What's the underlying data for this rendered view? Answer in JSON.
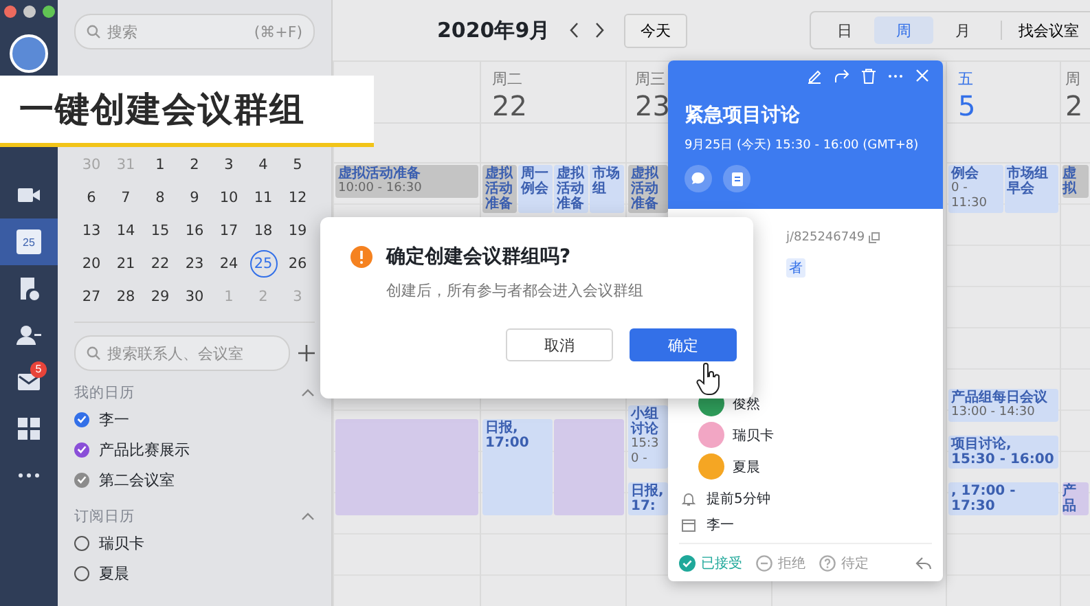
{
  "rail": {
    "items": [
      {
        "kind": "video",
        "selected": false
      },
      {
        "kind": "calendar",
        "label": "25",
        "selected": true
      },
      {
        "kind": "docs",
        "selected": false
      },
      {
        "kind": "contacts",
        "selected": false
      },
      {
        "kind": "mail",
        "badge": "5",
        "selected": false
      },
      {
        "kind": "apps",
        "selected": false
      },
      {
        "kind": "more",
        "selected": false
      }
    ]
  },
  "caption": "一键创建会议群组",
  "sidebar": {
    "search": {
      "placeholder": "搜索",
      "shortcut": "(⌘+F)"
    },
    "mini_calendar": {
      "weeks": [
        [
          {
            "label": "30",
            "muted": true,
            "selected": false
          },
          {
            "label": "31",
            "muted": true,
            "selected": false
          },
          {
            "label": "1",
            "muted": false,
            "selected": false
          },
          {
            "label": "2",
            "muted": false,
            "selected": false
          },
          {
            "label": "3",
            "muted": false,
            "selected": false
          },
          {
            "label": "4",
            "muted": false,
            "selected": false
          },
          {
            "label": "5",
            "muted": false,
            "selected": false
          }
        ],
        [
          {
            "label": "6",
            "muted": false,
            "selected": false
          },
          {
            "label": "7",
            "muted": false,
            "selected": false
          },
          {
            "label": "8",
            "muted": false,
            "selected": false
          },
          {
            "label": "9",
            "muted": false,
            "selected": false
          },
          {
            "label": "10",
            "muted": false,
            "selected": false
          },
          {
            "label": "11",
            "muted": false,
            "selected": false
          },
          {
            "label": "12",
            "muted": false,
            "selected": false
          }
        ],
        [
          {
            "label": "13",
            "muted": false,
            "selected": false
          },
          {
            "label": "14",
            "muted": false,
            "selected": false
          },
          {
            "label": "15",
            "muted": false,
            "selected": false
          },
          {
            "label": "16",
            "muted": false,
            "selected": false
          },
          {
            "label": "17",
            "muted": false,
            "selected": false
          },
          {
            "label": "18",
            "muted": false,
            "selected": false
          },
          {
            "label": "19",
            "muted": false,
            "selected": false
          }
        ],
        [
          {
            "label": "20",
            "muted": false,
            "selected": false
          },
          {
            "label": "21",
            "muted": false,
            "selected": false
          },
          {
            "label": "22",
            "muted": false,
            "selected": false
          },
          {
            "label": "23",
            "muted": false,
            "selected": false
          },
          {
            "label": "24",
            "muted": false,
            "selected": false
          },
          {
            "label": "25",
            "muted": false,
            "selected": true
          },
          {
            "label": "26",
            "muted": false,
            "selected": false
          }
        ],
        [
          {
            "label": "27",
            "muted": false,
            "selected": false
          },
          {
            "label": "28",
            "muted": false,
            "selected": false
          },
          {
            "label": "29",
            "muted": false,
            "selected": false
          },
          {
            "label": "30",
            "muted": false,
            "selected": false
          },
          {
            "label": "1",
            "muted": true,
            "selected": false
          },
          {
            "label": "2",
            "muted": true,
            "selected": false
          },
          {
            "label": "3",
            "muted": true,
            "selected": false
          }
        ]
      ]
    },
    "contact_search": {
      "placeholder": "搜索联系人、会议室"
    },
    "sections": [
      {
        "title": "我的日历",
        "expanded": true,
        "items": [
          {
            "label": "李一",
            "checked": true,
            "color": "#3370e8"
          },
          {
            "label": "产品比赛展示",
            "checked": true,
            "color": "#8a4fd8"
          },
          {
            "label": "第二会议室",
            "checked": true,
            "color": "#8c8c8c"
          }
        ]
      },
      {
        "title": "订阅日历",
        "expanded": true,
        "items": [
          {
            "label": "瑞贝卡",
            "checked": false,
            "color": "#555555"
          },
          {
            "label": "夏晨",
            "checked": false,
            "color": "#555555"
          }
        ]
      }
    ]
  },
  "header": {
    "title": "2020年9月",
    "today_button": "今天",
    "views": [
      {
        "label": "日",
        "selected": false
      },
      {
        "label": "周",
        "selected": true
      },
      {
        "label": "月",
        "selected": false
      }
    ],
    "room_button": "找会议室"
  },
  "columns": [
    {
      "rows": [
        [
          {
            "title": "虚拟活动准备",
            "time": "10:00 - 16:30",
            "color": "#c4c4c4"
          }
        ],
        [
          {
            "color": "#d3c9ea"
          }
        ]
      ]
    },
    {
      "weekday": "周二",
      "date": "22",
      "today": false,
      "rows": [
        [
          {
            "title": "虚拟活动准备",
            "color": "#c4c4c4"
          },
          {
            "title": "周一例会",
            "color": "#cfdcf5"
          },
          {
            "title": "虚拟活动准备",
            "color": "#cfdcf5"
          },
          {
            "title": "市场组",
            "color": "#cfdcf5"
          }
        ],
        [
          {
            "title": "日报, 17:00",
            "color": "#cfdcf5"
          },
          {
            "color": "#d3c9ea"
          }
        ]
      ]
    },
    {
      "weekday": "周三",
      "date": "23",
      "today": false,
      "rows": [
        [
          {
            "title": "虚拟活动准备",
            "color": "#c4c4c4"
          }
        ],
        [
          {
            "title": "小组讨论",
            "time": "15:30 -",
            "color": "#cfdcf5"
          }
        ],
        [
          {
            "title": "日报, 17:",
            "color": "#cfdcf5"
          }
        ]
      ]
    },
    {
      "weekday": "五",
      "date": "5",
      "today": true,
      "rows": [
        [
          {
            "title": "例会",
            "time": "0 - 11:30",
            "color": "#cfdcf5"
          },
          {
            "title": "市场组早会",
            "color": "#cfdcf5"
          }
        ],
        [
          {
            "title": "产品组每日会议",
            "time": "13:00 - 14:30",
            "color": "#cfdcf5"
          }
        ],
        [
          {
            "title": "项目讨论, 15:30 - 16:00",
            "color": "#cfdcf5"
          }
        ],
        [
          {
            "title": ", 17:00 - 17:30",
            "color": "#cfdcf5"
          }
        ]
      ]
    },
    {
      "weekday": "周",
      "date": "2",
      "today": false,
      "rows": [
        [
          {
            "title": "虚拟",
            "color": "#c4c4c4"
          }
        ],
        [
          {
            "title": "产品",
            "color": "#d3c9ea"
          }
        ]
      ]
    }
  ],
  "event_popover": {
    "title": "紧急项目讨论",
    "when": "9月25日 (今天) 15:30 - 16:00 (GMT+8)",
    "link": "j/825246749",
    "tag": "者",
    "attendees": [
      {
        "name": "俊然",
        "color": "#2f9e5b"
      },
      {
        "name": "瑞贝卡",
        "color": "#f2a6c4"
      },
      {
        "name": "夏晨",
        "color": "#f5a623"
      }
    ],
    "reminder": "提前5分钟",
    "calendar": "李一",
    "responses": [
      {
        "kind": "accept",
        "label": "已接受",
        "selected": true
      },
      {
        "kind": "decline",
        "label": "拒绝",
        "selected": false
      },
      {
        "kind": "tentative",
        "label": "待定",
        "selected": false
      }
    ]
  },
  "dialog": {
    "title": "确定创建会议群组吗?",
    "message": "创建后，所有参与者都会进入会议群组",
    "buttons": [
      {
        "kind": "secondary",
        "label": "取消"
      },
      {
        "kind": "primary",
        "label": "确定"
      }
    ]
  }
}
